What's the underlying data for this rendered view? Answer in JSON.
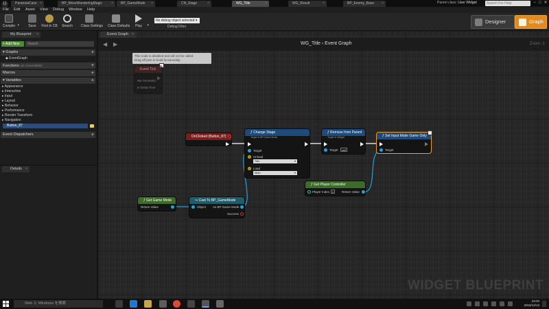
{
  "document_tabs": [
    "ParanoiaCave",
    "BP_MoveWanderingMagic",
    "BP_GameMode",
    "CN_Stage",
    "WG_Title",
    "WG_Result",
    "BP_Enemy_Base"
  ],
  "active_document_tab": "WG_Title",
  "parent_class": {
    "label": "Parent class:",
    "value": "User Widget"
  },
  "search_help_placeholder": "Search For Help",
  "window_controls": [
    "−",
    "□",
    "✕"
  ],
  "menu": [
    "File",
    "Edit",
    "Asset",
    "View",
    "Debug",
    "Window",
    "Help"
  ],
  "toolbar": {
    "compile": "Compile",
    "save": "Save",
    "find_in_cb": "Find in CB",
    "search": "Search",
    "class_settings": "Class Settings",
    "class_defaults": "Class Defaults",
    "play": "Play",
    "debug_select": "No debug object selected",
    "debug_filter": "Debug Filter"
  },
  "mode": {
    "designer": "Designer",
    "graph": "Graph"
  },
  "my_blueprint": {
    "tab": "My Blueprint",
    "add_new": "+ Add New",
    "search_placeholder": "Search",
    "graphs_header": "Graphs",
    "graphs": [
      "EventGraph"
    ],
    "functions_header": "Functions",
    "functions_note": "(31 Overridable)",
    "macros_header": "Macros",
    "variables_header": "Variables",
    "variable_categories": [
      "Appearance",
      "Interaction",
      "Input",
      "Layout",
      "Behavior",
      "Performance",
      "Render Transform",
      "Navigation"
    ],
    "variables": [
      "Button_87"
    ],
    "event_dispatchers_header": "Event Dispatchers"
  },
  "details_tab": "Details",
  "graph": {
    "tab": "Event Graph",
    "breadcrumb_widget": "WG_Title",
    "breadcrumb_sep": "›",
    "breadcrumb_graph": "Event Graph",
    "zoom": "Zoom -1",
    "watermark": "WIDGET BLUEPRINT",
    "disabled_note": "This node is disabled and will not be called.\nDrag off pins to build functionality.",
    "nodes": {
      "event_tick": {
        "title": "Event Tick",
        "pins": [
          "My Geometry",
          "In Delta Time"
        ]
      },
      "on_clicked": {
        "title": "OnClicked (Button_87)"
      },
      "change_stage": {
        "title": "Change Stage",
        "subtitle": "Target is BP Game Mode",
        "pins": [
          "Target",
          "Unload",
          "Load"
        ],
        "unload_value": "Title",
        "load_value": "Main"
      },
      "remove_from_parent": {
        "title": "Remove from Parent",
        "subtitle": "Target is Widget",
        "pins": [
          "Target"
        ],
        "target_value": "self"
      },
      "set_input_mode": {
        "title": "Set Input Mode Game Only",
        "pins": [
          "Target"
        ]
      },
      "get_player_controller": {
        "title": "Get Player Controller",
        "pins": [
          "Player Index",
          "Return Value"
        ],
        "player_index": "0"
      },
      "get_game_mode": {
        "title": "Get Game Mode",
        "pins": [
          "Return Value"
        ]
      },
      "cast_to_gamemode": {
        "title": "Cast To BP_GameMode",
        "pins": [
          "Object",
          "As BP Game Mode",
          "Success"
        ]
      }
    }
  },
  "taskbar": {
    "search_placeholder": "Web と Windows を検索",
    "time": "23:03",
    "date": "2016/12/13"
  },
  "colors": {
    "accent_orange": "#e08a1f",
    "event_red": "#7a1f1f",
    "function_blue": "#1e4b7a",
    "pure_green": "#3c6b2a",
    "cast_teal": "#1d5c68",
    "object_pin": "#1fa2e0"
  }
}
